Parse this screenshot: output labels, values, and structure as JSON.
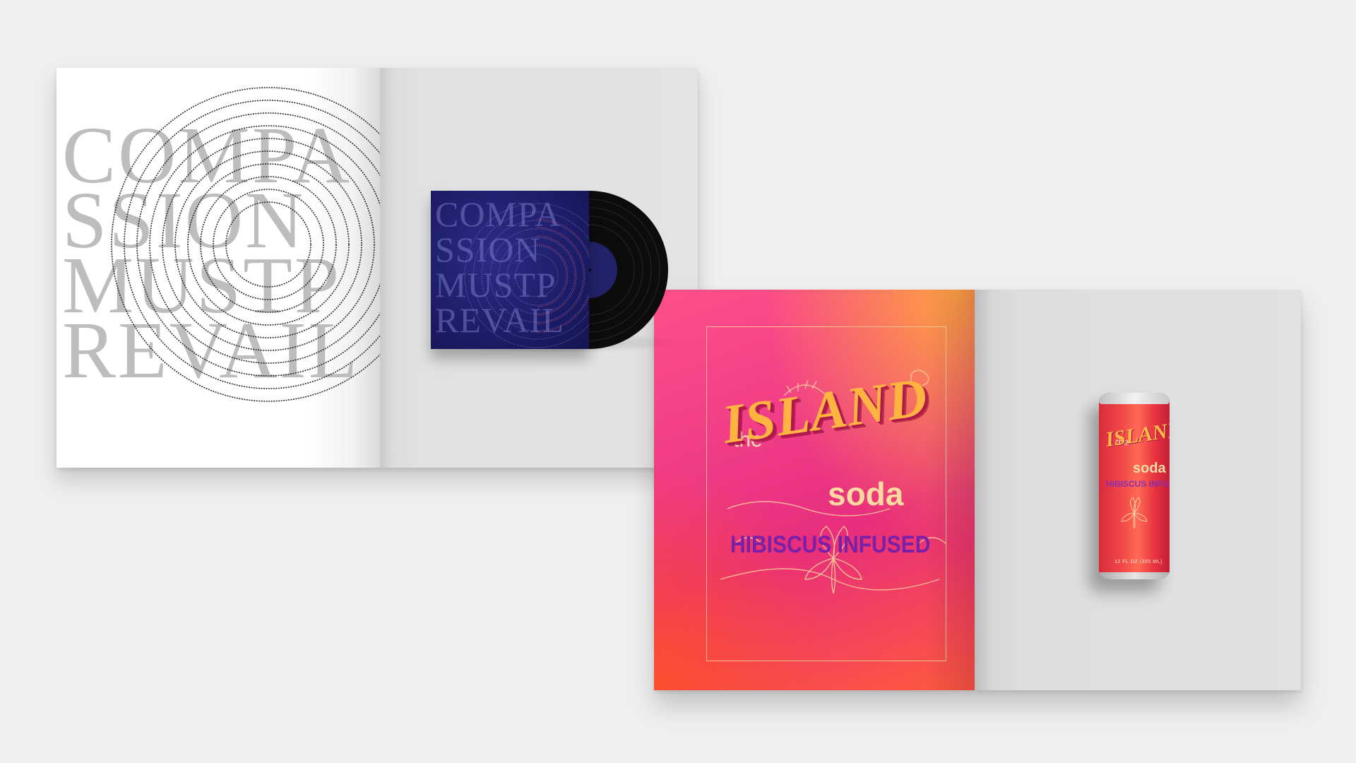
{
  "spread1": {
    "left_page_words": [
      "COMPA",
      "SSION",
      "MUSTP",
      "REVAIL"
    ],
    "album_cover_words": [
      "COMPA",
      "SSION",
      "MUSTP",
      "REVAIL"
    ],
    "label_text": "COMPASSION MUST PREVAIL"
  },
  "spread2": {
    "title_the": "the",
    "title_island": "ISLAND",
    "title_soda": "soda",
    "title_flavor": "HIBISCUS INFUSED",
    "can": {
      "the": "the",
      "island": "ISLAND",
      "soda": "soda",
      "flavor": "HIBISCUS INFUSED",
      "volume": "12 FL OZ (355 ML)"
    }
  },
  "colors": {
    "background": "#efefef",
    "album_navy": "#1a1a63",
    "soda_pink": "#ee3a86",
    "soda_orange": "#ff5a3c",
    "island_gold": "#ffb340",
    "hibiscus_purple": "#7a1fa8"
  }
}
